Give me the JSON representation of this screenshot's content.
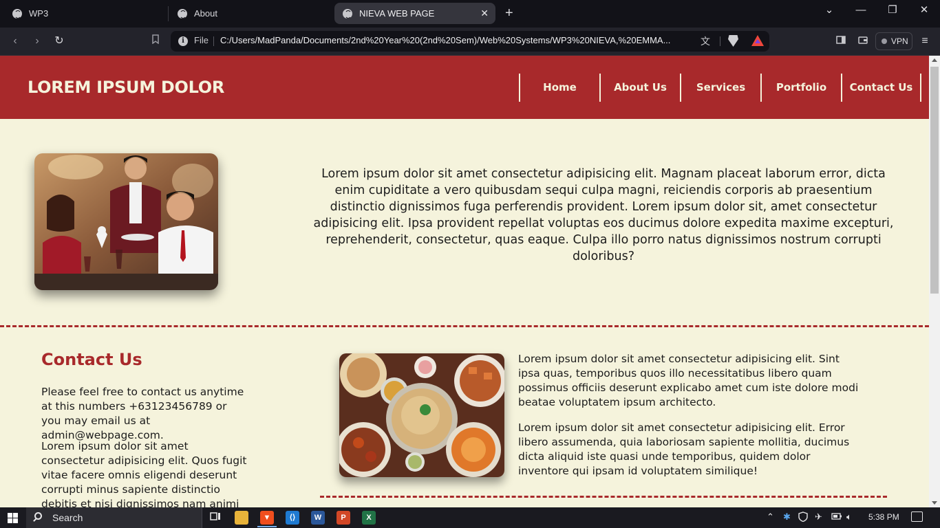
{
  "browser": {
    "tabs": [
      {
        "title": "WP3"
      },
      {
        "title": "About"
      },
      {
        "title": "NIEVA WEB PAGE"
      }
    ],
    "address": {
      "scheme_label": "File",
      "url": "C:/Users/MadPanda/Documents/2nd%20Year%20(2nd%20Sem)/Web%20Systems/WP3%20NIEVA,%20EMMA..."
    },
    "vpn_label": "VPN"
  },
  "site": {
    "logo": "LOREM IPSUM DOLOR",
    "nav": [
      "Home",
      "About Us",
      "Services",
      "Portfolio",
      "Contact Us"
    ],
    "hero_text": "Lorem ipsum dolor sit amet consectetur adipisicing elit. Magnam placeat laborum error, dicta enim cupiditate a vero quibusdam sequi culpa magni, reiciendis corporis ab praesentium distinctio dignissimos fuga perferendis provident. Lorem ipsum dolor sit, amet consectetur adipisicing elit. Ipsa provident repellat voluptas eos ducimus dolore expedita maxime excepturi, reprehenderit, consectetur, quas eaque. Culpa illo porro natus dignissimos nostrum corrupti doloribus?",
    "contact": {
      "title": "Contact Us",
      "p1": "Please feel free to contact us anytime at this numbers +63123456789 or you may email us at admin@webpage.com.",
      "p2": "Lorem ipsum dolor sit amet consectetur adipisicing elit. Quos fugit vitae facere omnis eligendi deserunt corrupti minus sapiente distinctio debitis et nisi dignissimos nam animi aut aliquam."
    },
    "side_p1": "Lorem ipsum dolor sit amet consectetur adipisicing elit. Sint ipsa quas, temporibus quos illo necessitatibus libero quam possimus officiis deserunt explicabo amet cum iste dolore modi beatae voluptatem ipsum architecto.",
    "side_p2": "Lorem ipsum dolor sit amet consectetur adipisicing elit. Error libero assumenda, quia laboriosam sapiente mollitia, ducimus dicta aliquid iste quasi unde temporibus, quidem dolor inventore qui ipsam id voluptatem similique!",
    "colors": {
      "primary": "#a8292b",
      "background": "#f5f3dc"
    }
  },
  "taskbar": {
    "search_placeholder": "Search",
    "time": "5:38 PM",
    "apps": [
      "task-view-icon",
      "file-explorer-icon",
      "brave-icon",
      "vscode-icon",
      "word-icon",
      "powerpoint-icon",
      "excel-icon"
    ]
  }
}
